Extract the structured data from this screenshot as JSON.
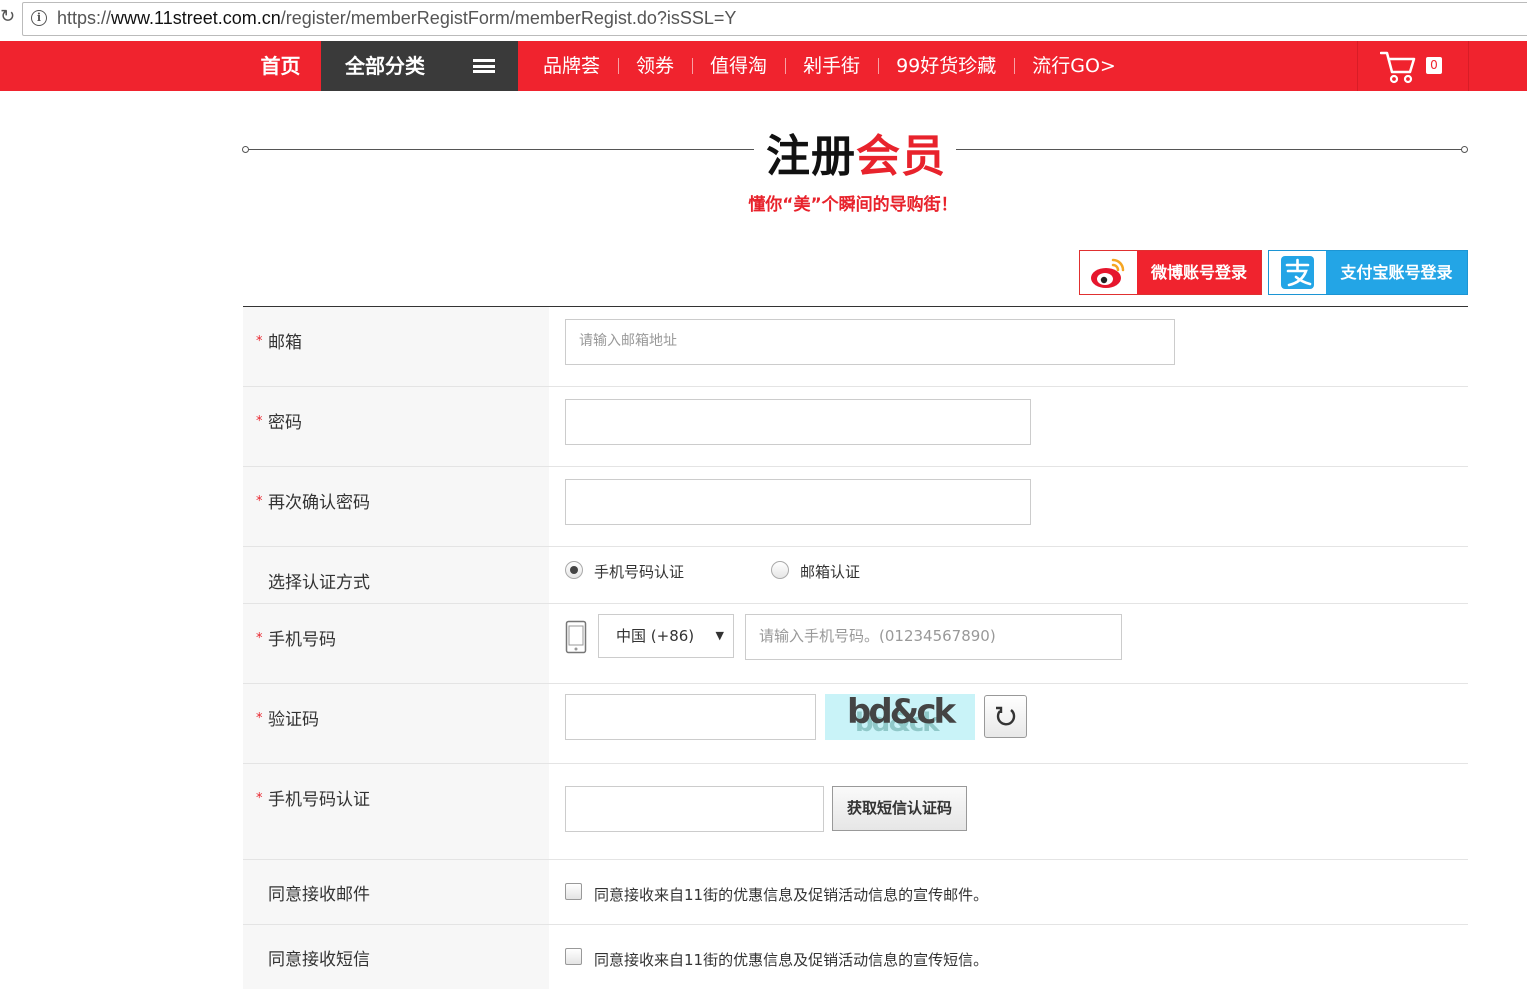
{
  "browser": {
    "url_prefix": "https://",
    "url_host": "www.11street.com.cn",
    "url_path": "/register/memberRegistForm/memberRegist.do?isSSL=Y"
  },
  "nav": {
    "home": "首页",
    "all_categories": "全部分类",
    "links": [
      "品牌荟",
      "领券",
      "值得淘",
      "剁手街",
      "99好货珍藏",
      "流行GO>"
    ],
    "cart_count": "0"
  },
  "page": {
    "title_black": "注册",
    "title_red": "会员",
    "subtitle": "懂你“美”个瞬间的导购街！"
  },
  "social": {
    "weibo_label": "微博账号登录",
    "alipay_label": "支付宝账号登录"
  },
  "form": {
    "email_label": "邮箱",
    "email_placeholder": "请输入邮箱地址",
    "password_label": "密码",
    "password_confirm_label": "再次确认密码",
    "verify_method_label": "选择认证方式",
    "verify_phone_option": "手机号码认证",
    "verify_email_option": "邮箱认证",
    "phone_label": "手机号码",
    "country_selected": "中国 (+86)",
    "phone_placeholder": "请输入手机号码。(01234567890)",
    "captcha_label": "验证码",
    "captcha_text": "bd&ck",
    "sms_label": "手机号码认证",
    "sms_button": "获取短信认证码",
    "agree_email_label": "同意接收邮件",
    "agree_email_text": "同意接收来自11街的优惠信息及促销活动信息的宣传邮件。",
    "agree_sms_label": "同意接收短信",
    "agree_sms_text": "同意接收来自11街的优惠信息及促销活动信息的宣传短信。"
  },
  "colors": {
    "brand_red": "#f0232e",
    "nav_dark": "#3a3a3a",
    "alipay_blue": "#23a5e6"
  }
}
